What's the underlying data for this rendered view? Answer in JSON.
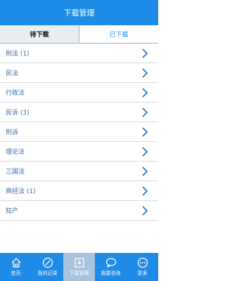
{
  "header": {
    "title": "下载管理"
  },
  "tabs": [
    {
      "label": "待下载",
      "active": true
    },
    {
      "label": "已下载",
      "active": false
    }
  ],
  "list": {
    "items": [
      {
        "label": "刑法 (1)"
      },
      {
        "label": "民法"
      },
      {
        "label": "行政法"
      },
      {
        "label": "民诉 (3)"
      },
      {
        "label": "刑诉"
      },
      {
        "label": "理论法"
      },
      {
        "label": "三国法"
      },
      {
        "label": "商经法 (1)"
      },
      {
        "label": "知产"
      }
    ]
  },
  "bottom_nav": {
    "items": [
      {
        "label": "首页",
        "icon": "home-icon"
      },
      {
        "label": "我的记录",
        "icon": "record-icon"
      },
      {
        "label": "下载管理",
        "icon": "download-icon",
        "active": true
      },
      {
        "label": "我要咨询",
        "icon": "chat-icon"
      },
      {
        "label": "更多",
        "icon": "more-icon"
      }
    ]
  },
  "colors": {
    "primary": "#1e8ce6",
    "active_tab_bg": "#e9eef3",
    "list_text": "#3a6ea5",
    "chevron": "#1e6fc0"
  }
}
